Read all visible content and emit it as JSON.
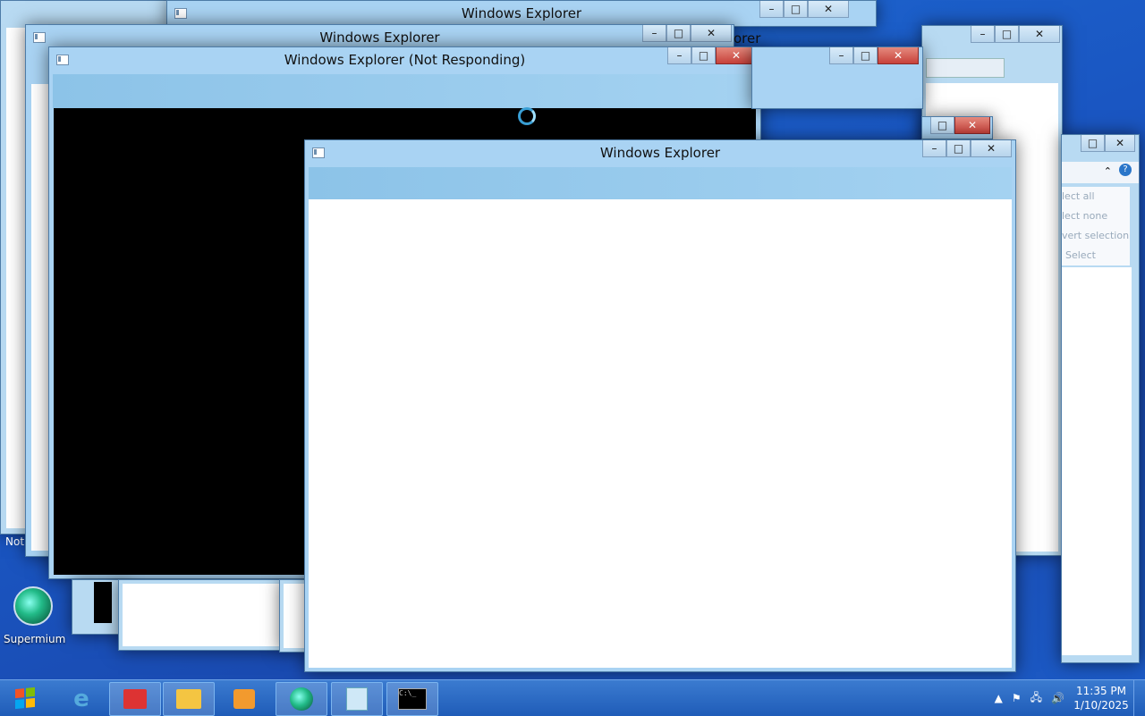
{
  "windows": [
    {
      "title": "Windows Explorer"
    },
    {
      "title": "Windows Explorer"
    },
    {
      "title": "Windows Explorer (Not Responding)"
    },
    {
      "title": "Windows Explorer"
    }
  ],
  "partial_title_fragment": "orer",
  "right_window_menu": [
    "lect all",
    "lect none",
    "vert selection",
    "Select"
  ],
  "left_edge_text": "Not",
  "desktop_icon": {
    "label": "Supermium",
    "icon": "supermium-globe-icon"
  },
  "taskbar": {
    "start": "windows-start-icon",
    "apps": [
      {
        "icon": "internet-explorer-icon"
      },
      {
        "icon": "gift-icon"
      },
      {
        "icon": "file-explorer-icon"
      },
      {
        "icon": "media-player-icon"
      },
      {
        "icon": "supermium-icon"
      },
      {
        "icon": "notepad-icon"
      },
      {
        "icon": "command-prompt-icon",
        "text": "C:\\_"
      }
    ],
    "tray": {
      "time": "11:35 PM",
      "date": "1/10/2025"
    }
  },
  "colors": {
    "accent": "#1a56c2",
    "titlebar": "#a9d3f3",
    "close": "#c7413a"
  }
}
